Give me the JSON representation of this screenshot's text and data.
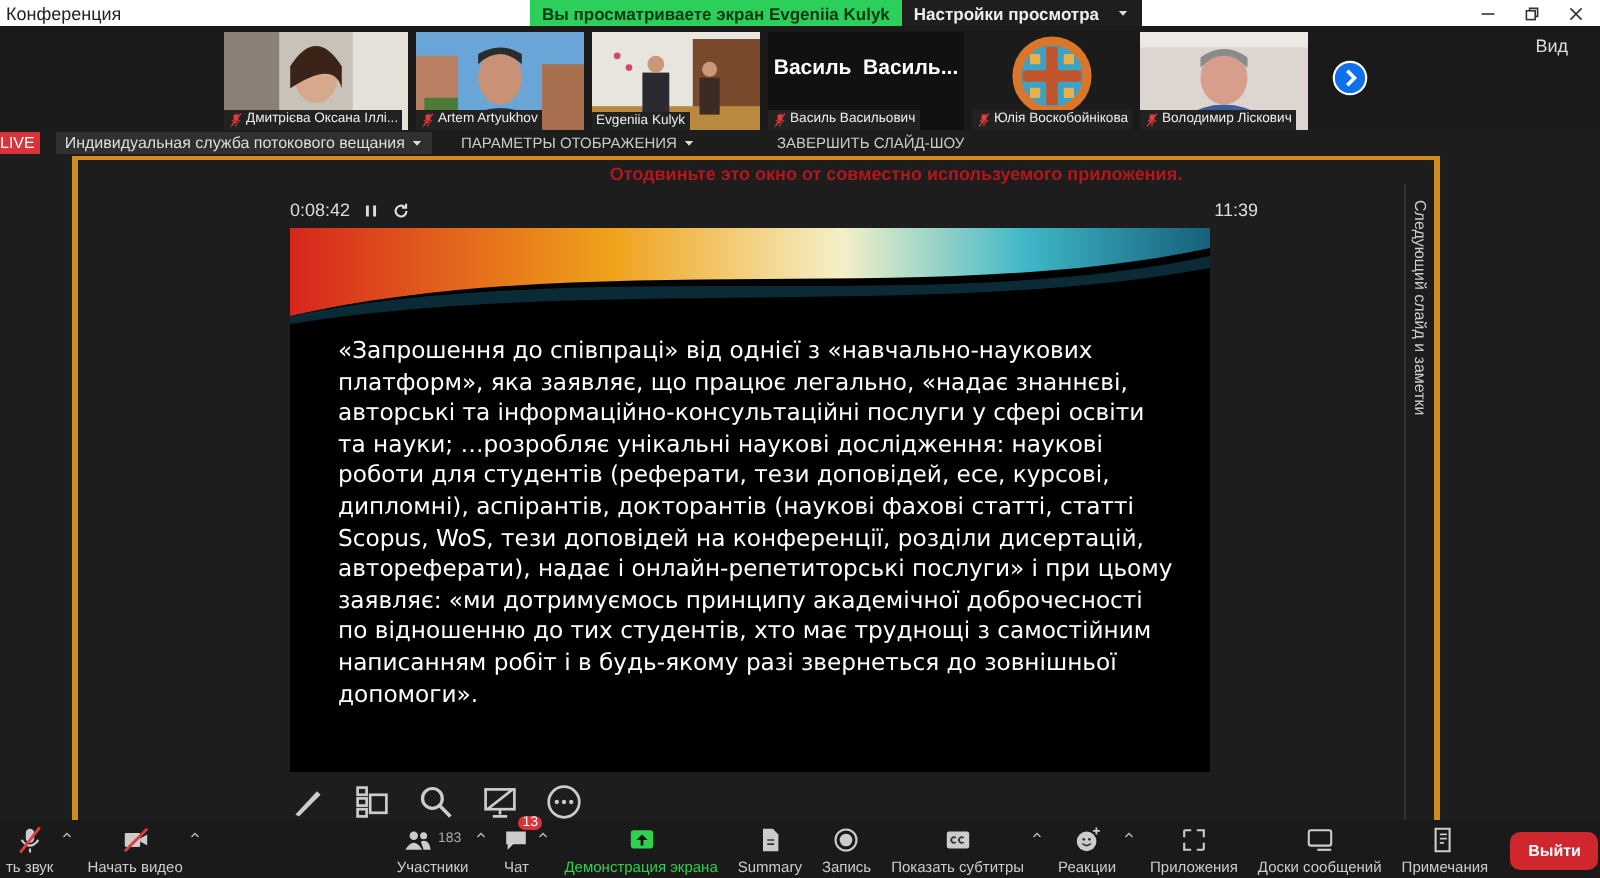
{
  "window": {
    "title": "Конференция",
    "share_banner": "Вы просматриваете экран Evgeniia Kulyk",
    "view_settings": "Настройки просмотра",
    "view_button": "Вид"
  },
  "participants": [
    {
      "kind": "video",
      "name": "Дмитрієва Оксана Іллі...",
      "muted": true
    },
    {
      "kind": "video",
      "name": "Artem Artyukhov",
      "muted": true
    },
    {
      "kind": "video",
      "name": "Evgeniia Kulyk",
      "muted": false
    },
    {
      "kind": "name",
      "display": "Василь  Василь...",
      "name": "Василь Васильович",
      "muted": true
    },
    {
      "kind": "avatar",
      "name": "Юлія Воскобойнікова",
      "muted": true
    },
    {
      "kind": "video",
      "name": "Володимир Ліскович",
      "muted": true
    }
  ],
  "shared": {
    "live": "LIVE",
    "stream_service": "Индивидуальная служба потокового вещания",
    "display_params": "ПАРАМЕТРЫ ОТОБРАЖЕНИЯ",
    "end_show": "ЗАВЕРШИТЬ СЛАЙД-ШОУ",
    "warning": "Отодвиньте это окно от совместно используемого приложения.",
    "elapsed": "0:08:42",
    "clock": "11:39",
    "next_slide": "Следующий слайд и заметки",
    "slide_text": "«Запрошення до співпраці» від однієї з «навчально-наукових платформ», яка заявляє, що працює легально, «надає знаннєві, авторські та інформаційно-консультаційні послуги у сфері освіти та науки; …розробляє унікальні наукові дослідження: наукові роботи для студентів (реферати, тези доповідей, есе, курсові, дипломні), аспірантів, докторантів (наукові фахові статті, статті Scopus, WoS, тези доповідей на конференції, розділи дисертацій, автореферати), надає і онлайн-репетиторські послуги» і при цьому заявляє: «ми дотримуємось принципу академічної доброчесності по відношенню до тих студентів, хто має труднощі з самостійним написанням робіт і в будь-якому разі звернеться до зовнішньої допомоги»."
  },
  "toolbar": [
    {
      "kind": "mic",
      "label": "ть звук",
      "caret": true
    },
    {
      "kind": "video",
      "label": "Начать видео",
      "caret": true
    },
    {
      "kind": "participants",
      "label": "Участники",
      "count": "183",
      "caret": true
    },
    {
      "kind": "chat",
      "label": "Чат",
      "badge": "13",
      "caret": true
    },
    {
      "kind": "share",
      "label": "Демонстрация экрана",
      "caret": false
    },
    {
      "kind": "summary",
      "label": "Summary",
      "caret": false
    },
    {
      "kind": "record",
      "label": "Запись",
      "caret": false
    },
    {
      "kind": "cc",
      "label": "Показать субтитры",
      "caret": true
    },
    {
      "kind": "reactions",
      "label": "Реакции",
      "caret": true
    },
    {
      "kind": "apps",
      "label": "Приложения",
      "caret": false
    },
    {
      "kind": "boards",
      "label": "Доски сообщений",
      "caret": false
    },
    {
      "kind": "notes",
      "label": "Примечания",
      "caret": false
    }
  ],
  "leave_button": "Выйти"
}
